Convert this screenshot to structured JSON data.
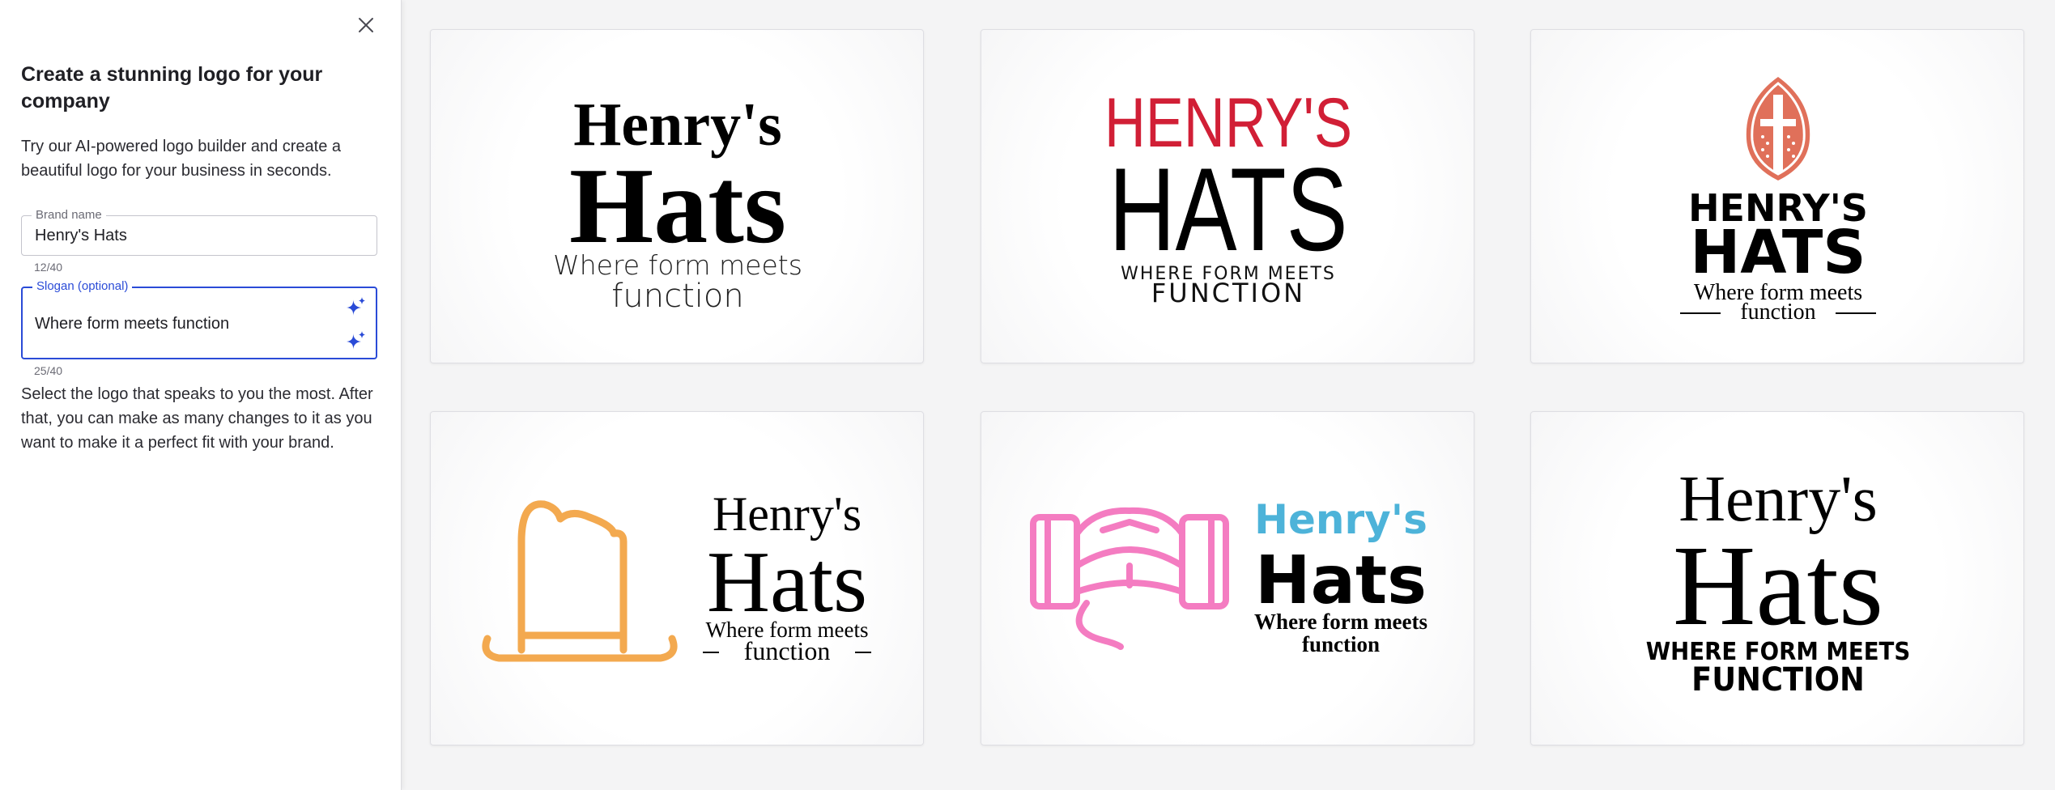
{
  "sidebar": {
    "title": "Create a stunning logo for your company",
    "intro": "Try our AI-powered logo builder and create a beautiful logo for your business in seconds.",
    "brand_field": {
      "label": "Brand name",
      "value": "Henry's Hats",
      "counter": "12/40"
    },
    "slogan_field": {
      "label": "Slogan (optional)",
      "value": "Where form meets function",
      "counter": "25/40"
    },
    "note": "Select the logo that speaks to you the most. After that, you can make as many changes to it as you want to make it a perfect fit with your brand.",
    "icons": {
      "close": "close-icon",
      "sparkle": "sparkle-icon"
    }
  },
  "logos": [
    {
      "line1": "Henry's",
      "line2": "Hats",
      "slogan1": "Where form meets",
      "slogan2": "function",
      "text_color": "#000000"
    },
    {
      "line1": "HENRY'S",
      "line2": "HATS",
      "slogan1": "WHERE FORM MEETS",
      "slogan2": "FUNCTION",
      "accent": "#d11f36",
      "text_color": "#000000"
    },
    {
      "line1": "HENRY'S",
      "line2": "HATS",
      "slogan1": "Where form meets",
      "slogan2": "function",
      "icon": "knight-helmet-icon",
      "accent": "#e0705a",
      "text_color": "#000000"
    },
    {
      "line1": "Henry's",
      "line2": "Hats",
      "slogan1": "Where form meets",
      "slogan2": "function",
      "icon": "cowboy-hat-icon",
      "accent": "#f3a94f",
      "text_color": "#000000"
    },
    {
      "line1": "Henry's",
      "line2": "Hats",
      "slogan1": "Where form meets",
      "slogan2": "function",
      "icon": "propeller-cap-icon",
      "accent": "#f47cc1",
      "accent2": "#4db3d9",
      "text_color": "#000000"
    },
    {
      "line1": "Henry's",
      "line2": "Hats",
      "slogan1": "WHERE FORM MEETS",
      "slogan2": "FUNCTION",
      "text_color": "#000000"
    }
  ],
  "colors": {
    "focus": "#2a4bd7",
    "sidebar_bg": "#ffffff",
    "gallery_bg": "#f4f4f5"
  }
}
